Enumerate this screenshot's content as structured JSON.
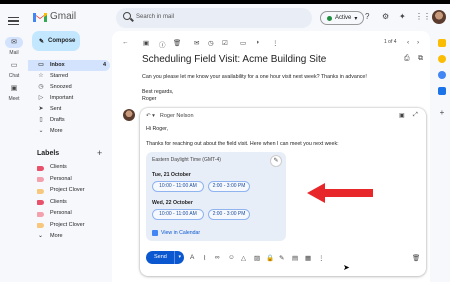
{
  "app": {
    "name": "Gmail"
  },
  "header": {
    "search_placeholder": "Search in mail",
    "status": "Active"
  },
  "rail": {
    "mail": "Mail",
    "chat": "Chat",
    "meet": "Meet"
  },
  "sidebar": {
    "compose": "Compose",
    "items": [
      {
        "label": "Inbox",
        "count": "4",
        "icon": "inbox-icon",
        "glyph": "▭"
      },
      {
        "label": "Starred",
        "count": "",
        "icon": "star-icon",
        "glyph": "☆"
      },
      {
        "label": "Snoozed",
        "count": "",
        "icon": "clock-icon",
        "glyph": "◷"
      },
      {
        "label": "Important",
        "count": "",
        "icon": "important-icon",
        "glyph": "▷"
      },
      {
        "label": "Sent",
        "count": "",
        "icon": "send-icon",
        "glyph": "➤"
      },
      {
        "label": "Drafts",
        "count": "",
        "icon": "draft-icon",
        "glyph": "▯"
      },
      {
        "label": "More",
        "count": "",
        "icon": "chevron-down-icon",
        "glyph": "⌄"
      }
    ],
    "labels_header": "Labels",
    "labels": [
      {
        "label": "Clients",
        "color": "#e9516a"
      },
      {
        "label": "Personal",
        "color": "#f3a1ad"
      },
      {
        "label": "Project Clover",
        "color": "#f8c77e"
      },
      {
        "label": "Clients",
        "color": "#e9516a"
      },
      {
        "label": "Personal",
        "color": "#f3a1ad"
      },
      {
        "label": "Project Clover",
        "color": "#f8c77e"
      },
      {
        "label": "More",
        "color": ""
      }
    ]
  },
  "thread": {
    "pager": "1 of 4",
    "subject": "Scheduling Field Visit: Acme Building Site",
    "body_line": "Can you please let me know your availability for a one hour visit next week? Thanks in advance!",
    "sign_1": "Best regards,",
    "sign_2": "Roger"
  },
  "reply": {
    "to": "Roger Nelson",
    "greeting": "Hi Roger,",
    "line": "Thanks for reaching out about the field visit. Here when I can meet you next week:",
    "timezone": "Eastern Daylight Time (GMT-4)",
    "days": [
      {
        "label": "Tue, 21 October",
        "slots": [
          "10:00 - 11:00 AM",
          "2:00 - 3:00 PM"
        ]
      },
      {
        "label": "Wed, 22 October",
        "slots": [
          "10:00 - 11:00 AM",
          "2:00 - 3:00 PM"
        ]
      }
    ],
    "view_calendar": "View in Calendar",
    "send": "Send"
  },
  "colors": {
    "accent": "#0b57d0",
    "compose_bg": "#c2e7ff",
    "arrow": "#e8272a",
    "card_bg": "#e8eef7"
  }
}
